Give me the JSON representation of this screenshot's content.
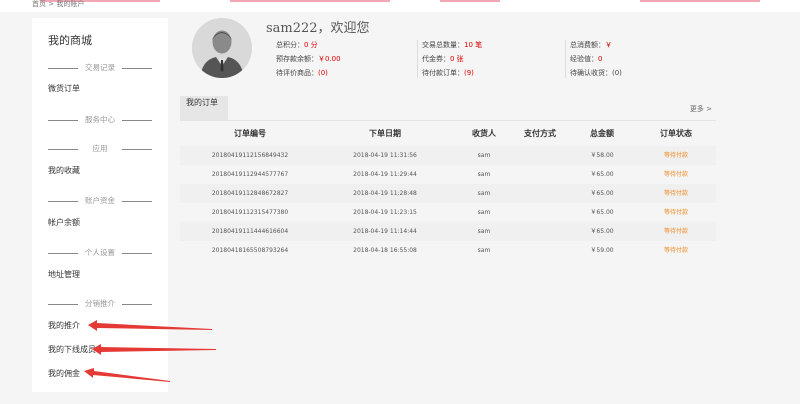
{
  "breadcrumb": "首页 > 我的账户",
  "sidebar": {
    "title": "我的商城",
    "sections": [
      {
        "label": "交易记录",
        "items": [
          "微货订单"
        ]
      },
      {
        "label": "服务中心",
        "items": []
      },
      {
        "label": "应用",
        "items": [
          "我的收藏"
        ]
      },
      {
        "label": "账户资金",
        "items": [
          "帐户余额"
        ]
      },
      {
        "label": "个人设置",
        "items": [
          "地址管理"
        ]
      },
      {
        "label": "分销推介",
        "items": [
          "我的推介",
          "我的下线成员",
          "我的佣金"
        ]
      }
    ]
  },
  "profile": {
    "greeting": "sam222，欢迎您",
    "stats": {
      "points_label": "总积分：",
      "points_value": "0 分",
      "prepaid_label": "预存款余额：",
      "prepaid_value": "￥0.00",
      "to_review_label": "待评价商品：",
      "to_review_value": "(0)",
      "trade_count_label": "交易总数量：",
      "trade_count_value": "10 笔",
      "coupon_label": "代金券：",
      "coupon_value": "0 张",
      "unpaid_label": "待付款订单：",
      "unpaid_value": "(9)",
      "total_spent_label": "总消费额：",
      "total_spent_value": "￥",
      "exp_label": "经验值：",
      "exp_value": "0",
      "to_confirm_label": "待确认收货：",
      "to_confirm_value": "(0)"
    }
  },
  "orders": {
    "tab": "我的订单",
    "more": "更多 >",
    "columns": [
      "订单编号",
      "下单日期",
      "收货人",
      "支付方式",
      "总金额",
      "订单状态"
    ],
    "rows": [
      {
        "id": "20180419112156849432",
        "date": "2018-04-19 11:31:56",
        "receiver": "sam",
        "pay": "",
        "amount": "￥58.00",
        "status": "等待付款"
      },
      {
        "id": "20180419112944577767",
        "date": "2018-04-19 11:29:44",
        "receiver": "sam",
        "pay": "",
        "amount": "￥65.00",
        "status": "等待付款"
      },
      {
        "id": "20180419112848672827",
        "date": "2018-04-19 11:28:48",
        "receiver": "sam",
        "pay": "",
        "amount": "￥65.00",
        "status": "等待付款"
      },
      {
        "id": "20180419112315477380",
        "date": "2018-04-19 11:23:15",
        "receiver": "sam",
        "pay": "",
        "amount": "￥65.00",
        "status": "等待付款"
      },
      {
        "id": "20180419111444616604",
        "date": "2018-04-19 11:14:44",
        "receiver": "sam",
        "pay": "",
        "amount": "￥65.00",
        "status": "等待付款"
      },
      {
        "id": "20180418165508793264",
        "date": "2018-04-18 16:55:08",
        "receiver": "sam",
        "pay": "",
        "amount": "￥59.00",
        "status": "等待付款"
      }
    ]
  },
  "colors": {
    "accent_red": "#dd0000",
    "status_orange": "#f08a24",
    "annotation_arrow": "#e53935"
  }
}
